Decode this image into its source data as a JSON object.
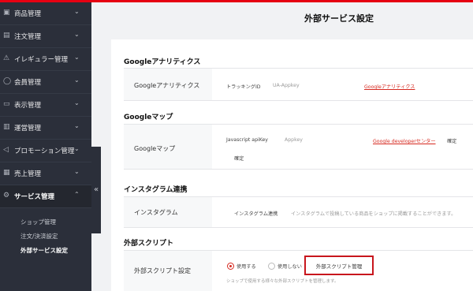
{
  "sidebar": {
    "items": [
      {
        "label": "商品管理",
        "icon": "box-icon"
      },
      {
        "label": "注文管理",
        "icon": "order-icon"
      },
      {
        "label": "イレギュラー管理",
        "icon": "alert-icon"
      },
      {
        "label": "会員管理",
        "icon": "user-icon"
      },
      {
        "label": "表示管理",
        "icon": "monitor-icon"
      },
      {
        "label": "運営管理",
        "icon": "clipboard-icon"
      },
      {
        "label": "プロモーション管理",
        "icon": "megaphone-icon"
      },
      {
        "label": "売上管理",
        "icon": "chart-icon"
      },
      {
        "label": "サービス管理",
        "icon": "gear-icon"
      }
    ],
    "subitems": [
      "ショップ管理",
      "注文/決済設定",
      "外部サービス設定"
    ],
    "collapse": "«"
  },
  "page": {
    "title": "外部サービス設定"
  },
  "sections": {
    "ga": {
      "heading": "Googleアナリティクス",
      "label": "Googleアナリティクス",
      "tracking_label": "トラッキングID",
      "tracking_placeholder": "UA-Appkey",
      "link": "Googleアナリティクス"
    },
    "maps": {
      "heading": "Googleマップ",
      "label": "Googleマップ",
      "key_label": "Javascript apiKey",
      "key_placeholder": "Appkey",
      "link": "Google developerセンター",
      "confirm1": "確定",
      "confirm2": "確定"
    },
    "instagram": {
      "heading": "インスタグラム連携",
      "label": "インスタグラム",
      "link_label": "インスタグラム連携",
      "description": "インスタグラムで投稿している商品をショップに掲載することができます。"
    },
    "script": {
      "heading": "外部スクリプト",
      "label": "外部スクリプト設定",
      "use": "使用する",
      "nouse": "使用しない",
      "button": "外部スクリプト管理",
      "note": "ショップで使用する様々な外部スクリプトを管理します。"
    }
  },
  "colors": {
    "accent": "#d6281f",
    "sidebar": "#2b2f3a"
  }
}
